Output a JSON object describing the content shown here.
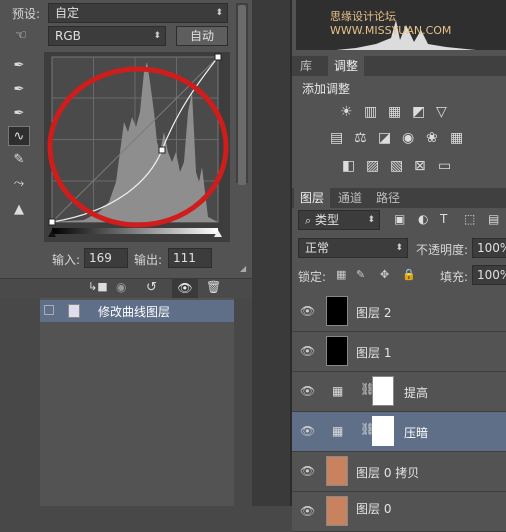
{
  "curves": {
    "preset_label": "预设:",
    "preset_value": "自定",
    "channel_value": "RGB",
    "auto_label": "自动",
    "input_label": "输入:",
    "input_value": "169",
    "output_label": "输出:",
    "output_value": "111",
    "history_item": "修改曲线图层"
  },
  "top_strip": {
    "tabs": [
      "库",
      "调整"
    ]
  },
  "adjustments": {
    "title": "添加调整"
  },
  "layers": {
    "tabs": [
      "图层",
      "通道",
      "路径"
    ],
    "filter_value": "类型",
    "blend_mode": "正常",
    "opacity_label": "不透明度:",
    "opacity_value": "100%",
    "lock_label": "锁定:",
    "fill_label": "填充:",
    "fill_value": "100%",
    "rows": [
      {
        "name": "图层 2"
      },
      {
        "name": "图层 1"
      },
      {
        "name": "提高"
      },
      {
        "name": "压暗"
      },
      {
        "name": "图层 0 拷贝"
      },
      {
        "name": "图层 0"
      }
    ]
  },
  "watermark": "思缘设计论坛 WWW.MISSYUAN.COM",
  "colors": {
    "annotation_circle": "#d11c1c",
    "selected_row": "#5f6f88"
  }
}
